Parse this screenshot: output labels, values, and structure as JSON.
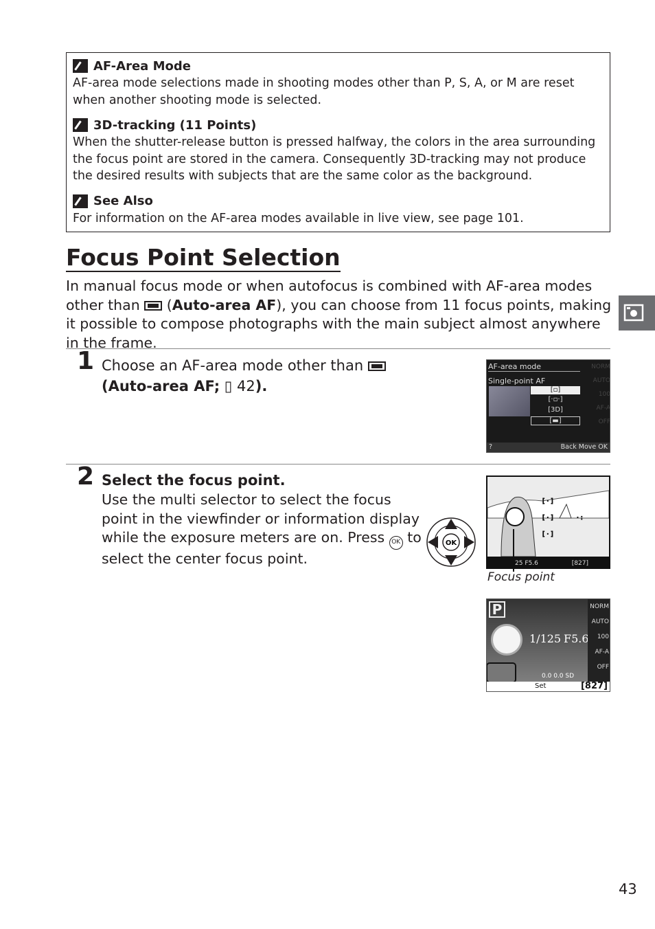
{
  "notes": [
    {
      "title": "AF-Area Mode",
      "body": "AF-area mode selections made in shooting modes other than P, S, A, or M are reset when another shooting mode is selected."
    },
    {
      "title": "3D-tracking (11 Points)",
      "body": "When the shutter-release button is pressed halfway, the colors in the area surrounding the focus point are stored in the camera.  Consequently 3D-tracking may not produce the desired results with subjects that are the same color as the background."
    },
    {
      "title": "See Also",
      "body": "For information on the AF-area modes available in live view, see page 101."
    }
  ],
  "heading": "Focus Point Selection",
  "intro": {
    "a": "In manual focus mode or when autofocus is combined with AF-area modes other than ",
    "b": " (",
    "bold": "Auto-area AF",
    "c": "), you can choose from 11 focus points, making it possible to compose photographs with the main subject almost anywhere in the frame."
  },
  "steps": [
    {
      "number": "1",
      "title_a": "Choose an AF-area mode other than ",
      "title_b": "(",
      "title_bold": "Auto-area AF;",
      "title_ref": "42",
      "title_c": ")."
    },
    {
      "number": "2",
      "title": "Select the focus point.",
      "body_a": "Use the multi selector to select the focus point in the viewfinder or information display while the exposure meters are on.  Press ",
      "body_b": " to select the center focus point."
    }
  ],
  "screen1": {
    "title": "AF-area mode",
    "selected": "Single-point AF",
    "options": [
      "[▫]",
      "[·▫·]",
      "[3D]",
      "[▬]"
    ],
    "right": [
      "NORM",
      "AUTO",
      "100",
      "AF-A",
      "OFF"
    ],
    "footer": {
      "help": "?",
      "back": "Back",
      "move": "Move",
      "ok": "OK"
    }
  },
  "viewfinder": {
    "shutter": "25",
    "aperture": "F5.6",
    "frames": "[827]",
    "caption": "Focus point"
  },
  "screen3": {
    "mode": "P",
    "shutter": "1/125",
    "aperture": "F5.6",
    "right": [
      "NORM",
      "AUTO",
      "100",
      "AF-A",
      "OFF"
    ],
    "bottom": [
      "0.0",
      "0.0",
      "SD"
    ],
    "set": "Set",
    "frames": "[827]"
  },
  "ok_label": "OK",
  "page_number": "43"
}
